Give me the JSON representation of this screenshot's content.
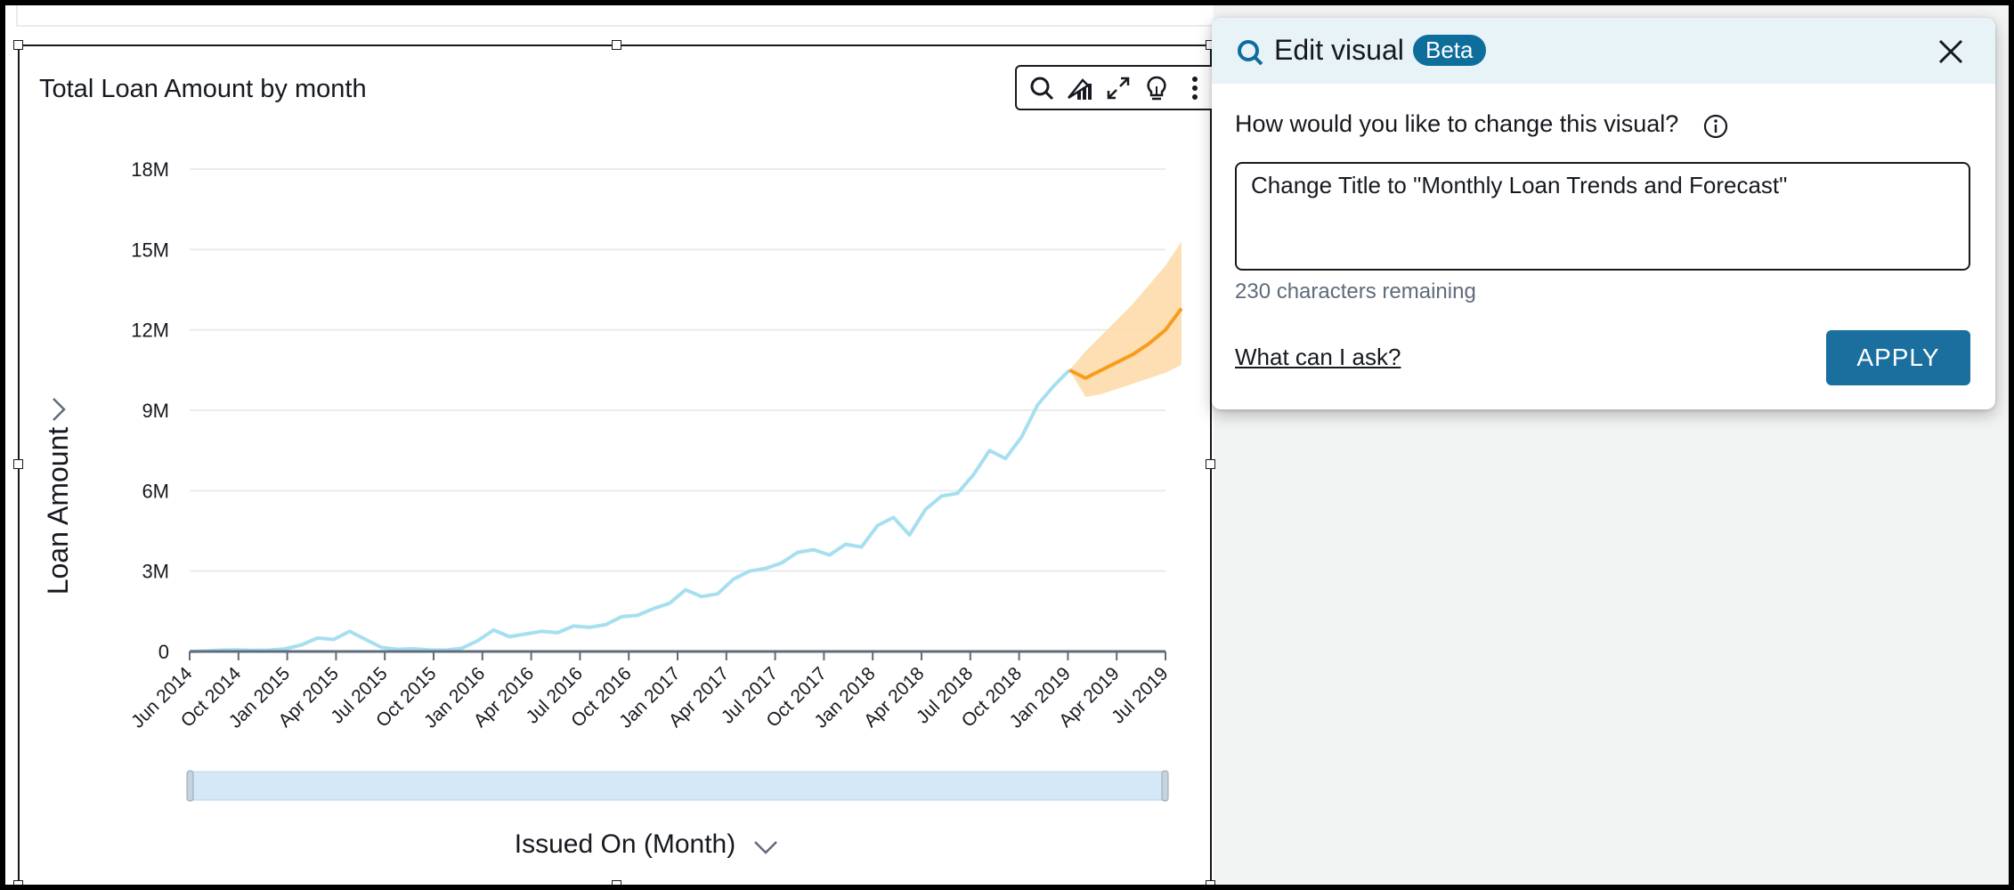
{
  "visual": {
    "title": "Total Loan Amount by month",
    "y_axis_label": "Loan Amount",
    "x_axis_field": "Issued On (Month)"
  },
  "toolbar": {
    "icons": [
      "search-icon",
      "format-chart-icon",
      "expand-icon",
      "insight-bulb-icon",
      "more-options-icon"
    ]
  },
  "edit_panel": {
    "title": "Edit visual",
    "badge": "Beta",
    "question": "How would you like to change this visual?",
    "input_value": "Change Title to \"Monthly Loan Trends and Forecast\"",
    "chars_remaining": "230 characters remaining",
    "help_link": "What can I ask?",
    "apply_label": "APPLY"
  },
  "colors": {
    "actual_line": "#a6dff0",
    "forecast_line": "#f89c1c",
    "forecast_band": "#fdd9a6",
    "accent": "#1a6f9f"
  },
  "chart_data": {
    "type": "line",
    "title": "Total Loan Amount by month",
    "xlabel": "Issued On (Month)",
    "ylabel": "Loan Amount",
    "y_ticks": [
      "0",
      "3M",
      "6M",
      "9M",
      "12M",
      "15M",
      "18M"
    ],
    "ylim": [
      0,
      18000000
    ],
    "x_ticks": [
      "Jun 2014",
      "Oct 2014",
      "Jan 2015",
      "Apr 2015",
      "Jul 2015",
      "Oct 2015",
      "Jan 2016",
      "Apr 2016",
      "Jul 2016",
      "Oct 2016",
      "Jan 2017",
      "Apr 2017",
      "Jul 2017",
      "Oct 2017",
      "Jan 2018",
      "Apr 2018",
      "Jul 2018",
      "Oct 2018",
      "Jan 2019",
      "Apr 2019",
      "Jul 2019"
    ],
    "grid": true,
    "series": [
      {
        "kind": "actual",
        "points": [
          [
            "2014-06",
            0
          ],
          [
            "2014-07",
            20000
          ],
          [
            "2014-08",
            50000
          ],
          [
            "2014-09",
            60000
          ],
          [
            "2014-10",
            40000
          ],
          [
            "2014-11",
            50000
          ],
          [
            "2014-12",
            100000
          ],
          [
            "2015-01",
            250000
          ],
          [
            "2015-02",
            500000
          ],
          [
            "2015-03",
            450000
          ],
          [
            "2015-04",
            750000
          ],
          [
            "2015-05",
            450000
          ],
          [
            "2015-06",
            150000
          ],
          [
            "2015-07",
            80000
          ],
          [
            "2015-08",
            100000
          ],
          [
            "2015-09",
            60000
          ],
          [
            "2015-10",
            50000
          ],
          [
            "2015-11",
            120000
          ],
          [
            "2015-12",
            400000
          ],
          [
            "2016-01",
            800000
          ],
          [
            "2016-02",
            550000
          ],
          [
            "2016-03",
            650000
          ],
          [
            "2016-04",
            750000
          ],
          [
            "2016-05",
            700000
          ],
          [
            "2016-06",
            950000
          ],
          [
            "2016-07",
            900000
          ],
          [
            "2016-08",
            1000000
          ],
          [
            "2016-09",
            1300000
          ],
          [
            "2016-10",
            1350000
          ],
          [
            "2016-11",
            1600000
          ],
          [
            "2016-12",
            1800000
          ],
          [
            "2017-01",
            2300000
          ],
          [
            "2017-02",
            2050000
          ],
          [
            "2017-03",
            2150000
          ],
          [
            "2017-04",
            2700000
          ],
          [
            "2017-05",
            3000000
          ],
          [
            "2017-06",
            3100000
          ],
          [
            "2017-07",
            3300000
          ],
          [
            "2017-08",
            3700000
          ],
          [
            "2017-09",
            3800000
          ],
          [
            "2017-10",
            3600000
          ],
          [
            "2017-11",
            4000000
          ],
          [
            "2017-12",
            3900000
          ],
          [
            "2018-01",
            4700000
          ],
          [
            "2018-02",
            5000000
          ],
          [
            "2018-03",
            4350000
          ],
          [
            "2018-04",
            5300000
          ],
          [
            "2018-05",
            5800000
          ],
          [
            "2018-06",
            5900000
          ],
          [
            "2018-07",
            6600000
          ],
          [
            "2018-08",
            7500000
          ],
          [
            "2018-09",
            7200000
          ],
          [
            "2018-10",
            8000000
          ],
          [
            "2018-11",
            9200000
          ],
          [
            "2018-12",
            9900000
          ],
          [
            "2019-01",
            10500000
          ]
        ]
      },
      {
        "kind": "forecast",
        "points": [
          [
            "2019-01",
            10500000
          ],
          [
            "2019-02",
            10200000
          ],
          [
            "2019-03",
            10500000
          ],
          [
            "2019-04",
            10800000
          ],
          [
            "2019-05",
            11100000
          ],
          [
            "2019-06",
            11500000
          ],
          [
            "2019-07",
            12000000
          ],
          [
            "2019-08",
            12800000
          ]
        ],
        "upper": [
          10500000,
          11200000,
          11800000,
          12400000,
          13000000,
          13700000,
          14400000,
          15300000
        ],
        "lower": [
          10500000,
          9500000,
          9600000,
          9800000,
          10000000,
          10200000,
          10400000,
          10700000
        ]
      }
    ]
  }
}
